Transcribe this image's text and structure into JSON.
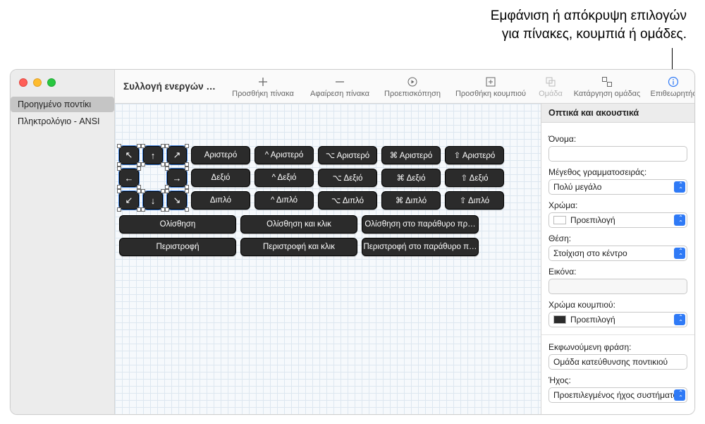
{
  "annotation": {
    "line1": "Εμφάνιση ή απόκρυψη επιλογών",
    "line2": "για πίνακες, κουμπιά ή ομάδες."
  },
  "sidebar": {
    "items": [
      {
        "label": "Προηγμένο ποντίκι",
        "active": true
      },
      {
        "label": "Πληκτρολόγιο - ANSI",
        "active": false
      }
    ]
  },
  "toolbar": {
    "title": "Συλλογή ενεργών πι…",
    "add_panel": "Προσθήκη πίνακα",
    "remove_panel": "Αφαίρεση πίνακα",
    "preview": "Προεπισκόπηση",
    "add_button": "Προσθήκη κουμπιού",
    "group": "Ομάδα",
    "ungroup": "Κατάργηση ομάδας",
    "inspector": "Επιθεωρητής"
  },
  "arrows": {
    "r0": [
      "↖",
      "↑",
      "↗"
    ],
    "r1": [
      "←",
      "",
      "→"
    ],
    "r2": [
      "↙",
      "↓",
      "↘"
    ]
  },
  "rows": {
    "r0": [
      "Αριστερό",
      "^ Αριστερό",
      "⌥ Αριστερό",
      "⌘ Αριστερό",
      "⇧ Αριστερό"
    ],
    "r1": [
      "Δεξιό",
      "^ Δεξιό",
      "⌥ Δεξιό",
      "⌘ Δεξιό",
      "⇧ Δεξιό"
    ],
    "r2": [
      "Διπλό",
      "^ Διπλό",
      "⌥ Διπλό",
      "⌘ Διπλό",
      "⇧ Διπλό"
    ]
  },
  "wide": {
    "r0": [
      "Ολίσθηση",
      "Ολίσθηση και κλικ",
      "Ολίσθηση στο παράθυρο πρ…"
    ],
    "r1": [
      "Περιστροφή",
      "Περιστροφή και κλικ",
      "Περιστροφή στο παράθυρο π…"
    ]
  },
  "inspector": {
    "title": "Οπτικά και ακουστικά",
    "name_label": "Όνομα:",
    "name_value": "",
    "font_size_label": "Μέγεθος γραμματοσειράς:",
    "font_size_value": "Πολύ μεγάλο",
    "color_label": "Χρώμα:",
    "color_value": "Προεπιλογή",
    "position_label": "Θέση:",
    "position_value": "Στοίχιση στο κέντρο",
    "image_label": "Εικόνα:",
    "image_value": "",
    "btn_color_label": "Χρώμα κουμπιού:",
    "btn_color_value": "Προεπιλογή",
    "phrase_label": "Εκφωνούμενη φράση:",
    "phrase_value": "Ομάδα κατεύθυνσης ποντικιού",
    "sound_label": "Ήχος:",
    "sound_value": "Προεπιλεγμένος ήχος συστήματος"
  }
}
